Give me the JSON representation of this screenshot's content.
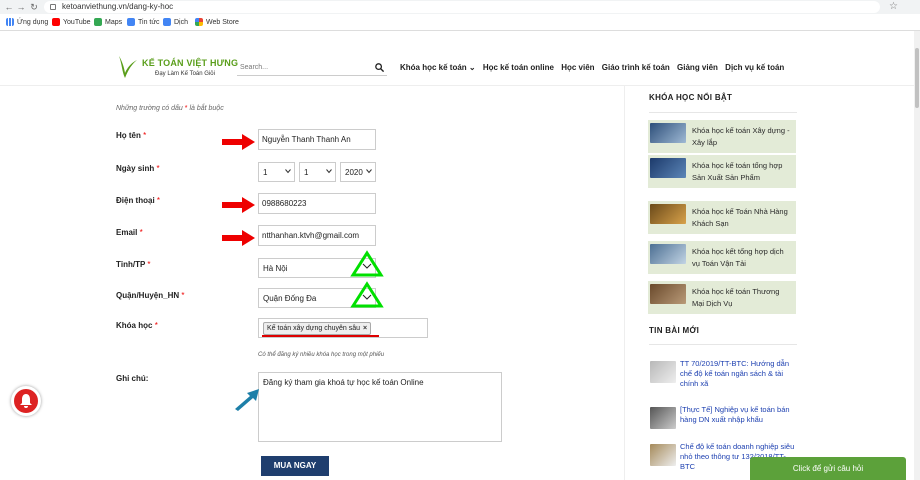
{
  "browser": {
    "url": "ketoanviethung.vn/dang-ky-hoc",
    "bookmarks": [
      {
        "label": "Ứng dụng",
        "icon": "apps-grid-icon",
        "color": "#4285f4"
      },
      {
        "label": "YouTube",
        "icon": "youtube-icon",
        "color": "#ff0000"
      },
      {
        "label": "Maps",
        "icon": "maps-icon",
        "color": "#34a853"
      },
      {
        "label": "Tin tức",
        "icon": "news-icon",
        "color": "#4285f4"
      },
      {
        "label": "Dịch",
        "icon": "translate-icon",
        "color": "#4285f4"
      },
      {
        "label": "Web Store",
        "icon": "webstore-icon",
        "color": "#fbbc05"
      }
    ]
  },
  "header": {
    "logo_title": "KẾ TOÁN VIỆT HƯNG",
    "logo_sub": "Đạy Làm Kế Toán Giỏi",
    "search_placeholder": "Search...",
    "nav": [
      "Khóa học kế toán ⌄",
      "Học kế toán online",
      "Học viên",
      "Giáo trình kế toán",
      "Giảng viên",
      "Dịch vụ kế toán"
    ]
  },
  "form": {
    "hint": "Những trường có dấu",
    "hint_suffix": "là bắt buộc",
    "req_mark": "*",
    "fullname_label": "Họ tên",
    "fullname_value": "Nguyễn Thanh Thanh An",
    "dob_label": "Ngày sinh",
    "dob_day": "1",
    "dob_month": "1",
    "dob_year": "2020",
    "phone_label": "Điện thoại",
    "phone_value": "0988680223",
    "email_label": "Email",
    "email_value": "ntthanhan.ktvh@gmail.com",
    "province_label": "Tỉnh/TP",
    "province_value": "Hà Nội",
    "district_label": "Quận/Huyện_HN",
    "district_value": "Quận Đống Đa",
    "course_label": "Khóa học",
    "course_tag": "Kế toán xây dựng chuyên sâu",
    "course_hint": "Có thể đăng ký nhiều khóa học trong một phiếu",
    "note_label": "Ghi chú:",
    "note_value": "Đăng ký tham gia khoá tự học kế toán Online",
    "submit_label": "MUA NGAY"
  },
  "sidebar": {
    "featured_title": "KHÓA HỌC NỔI BẬT",
    "courses": [
      "Khóa học kế toán Xây dựng - Xây lắp",
      "Khóa học kế toán tổng hợp Sản Xuất Sản Phẩm",
      "Khóa học kế Toán Nhà Hàng Khách Sạn",
      "Khóa học kết tổng hợp dịch vụ Toán Vận Tải",
      "Khóa học kế toán Thương Mại Dịch Vụ"
    ],
    "news_title": "TIN BÀI MỚI",
    "news": [
      "TT 70/2019/TT-BTC: Hướng dẫn chế độ kế toán ngân sách & tài chính xã",
      "[Thực Tế] Nghiệp vụ kế toán bán hàng DN xuất nhập khẩu",
      "Chế độ kế toán doanh nghiệp siêu nhỏ theo thông tư 132/2018/TT-BTC"
    ]
  },
  "chat": {
    "label": "Click để gửi câu hỏi"
  },
  "colors": {
    "brand_green": "#5a9e1b",
    "submit_blue": "#1f3e6e",
    "annotation_red": "#e00000",
    "annotation_green": "#00e000",
    "annotation_blue": "#1d7fa8"
  }
}
